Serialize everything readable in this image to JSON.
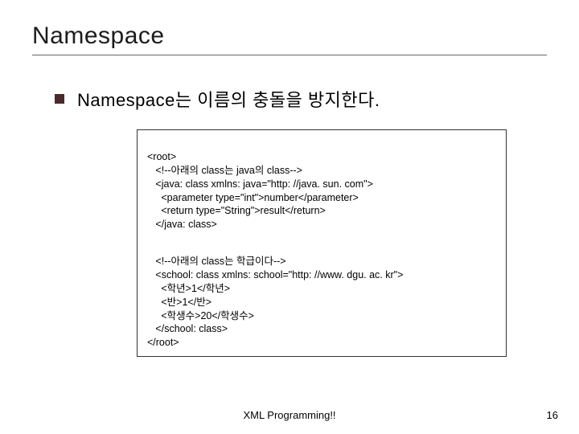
{
  "title": "Namespace",
  "bullet": "Namespace는 이름의 충돌을 방지한다.",
  "code": {
    "l1": "<root>",
    "l2": "   <!--아래의 class는 java의 class-->",
    "l3": "   <java: class xmlns: java=\"http: //java. sun. com\">",
    "l4": "     <parameter type=\"int\">number</parameter>",
    "l5": "     <return type=\"String\">result</return>",
    "l6": "   </java: class>",
    "l7": "   <!--아래의 class는 학급이다-->",
    "l8": "   <school: class xmlns: school=\"http: //www. dgu. ac. kr\">",
    "l9": "     <학년>1</학년>",
    "l10": "     <반>1</반>",
    "l11": "     <학생수>20</학생수>",
    "l12": "   </school: class>",
    "l13": "</root>"
  },
  "footer": "XML Programming!!",
  "page": "16"
}
